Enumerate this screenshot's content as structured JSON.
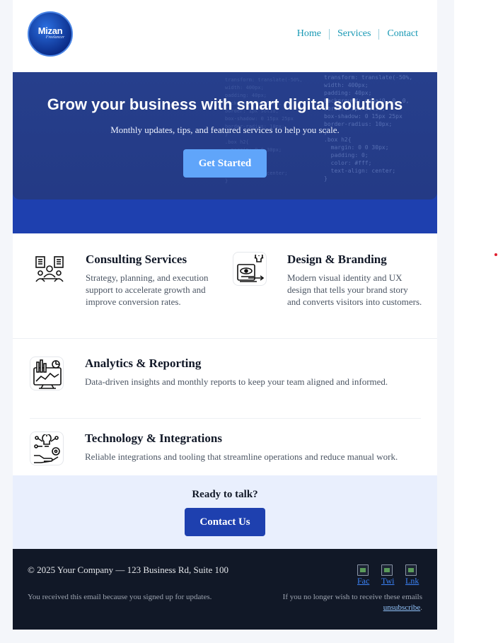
{
  "brand": {
    "logo_main": "Mizan",
    "logo_sub": "Freelancer"
  },
  "nav": [
    {
      "label": "Home"
    },
    {
      "label": "Services"
    },
    {
      "label": "Contact"
    }
  ],
  "hero": {
    "title": "Grow your business with smart digital solutions",
    "subtitle": "Monthly updates, tips, and featured services to help you scale.",
    "button": "Get Started",
    "code_text": "transform: translate(-50%,\nwidth: 400px;\npadding: 40px;\nbackground: rgba(0, 0, 0,\nborder: 1px solid;\nbox-shadow: 0 15px 25px\nborder-radius: 10px;\n}\n.box h2{\n  margin: 0 0 30px;\n  padding: 0;\n  color: #fff;\n  text-align: center;\n}"
  },
  "services": [
    {
      "title": "Consulting Services",
      "desc": "Strategy, planning, and execution support to accelerate growth and improve conversion rates.",
      "icon": "consulting-icon"
    },
    {
      "title": "Design & Branding",
      "desc": "Modern visual identity and UX design that tells your brand story and converts visitors into customers.",
      "icon": "design-icon"
    },
    {
      "title": "Analytics & Reporting",
      "desc": "Data-driven insights and monthly reports to keep your team aligned and informed.",
      "icon": "analytics-icon"
    },
    {
      "title": "Technology & Integrations",
      "desc": "Reliable integrations and tooling that streamline operations and reduce manual work.",
      "icon": "technology-icon"
    }
  ],
  "cta": {
    "title": "Ready to talk?",
    "button": "Contact Us"
  },
  "footer": {
    "copyright": "© 2025 Your Company — 123 Business Rd, Suite 100",
    "reason": "You received this email because you signed up for updates.",
    "unsub_prefix": "If you no longer wish to receive these emails ",
    "unsub_link": "unsubscribe",
    "unsub_suffix": ".",
    "social": [
      {
        "alt": "Fac",
        "icon": "facebook-icon"
      },
      {
        "alt": "Twi",
        "icon": "twitter-icon"
      },
      {
        "alt": "Lnk",
        "icon": "linkedin-icon"
      }
    ]
  },
  "colors": {
    "primary": "#1e40af",
    "accent": "#60a5fa",
    "nav_link": "#1798b4",
    "footer_bg": "#111827",
    "cta_bg": "#e9effd"
  }
}
